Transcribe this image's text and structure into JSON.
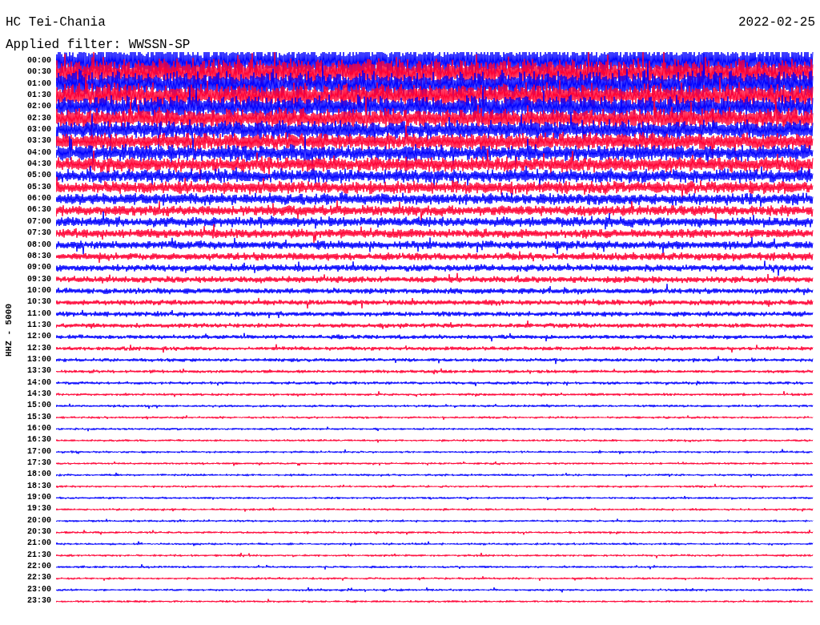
{
  "header": {
    "station": "HC Tei-Chania",
    "date": "2022-02-25",
    "filter": "Applied filter: WWSSN-SP"
  },
  "axis_label": "HHZ - 5000",
  "rows": [
    {
      "time": "00:00",
      "color": "#0000ff"
    },
    {
      "time": "00:30",
      "color": "#ff0033"
    },
    {
      "time": "01:00",
      "color": "#0000ff"
    },
    {
      "time": "01:30",
      "color": "#ff0033"
    },
    {
      "time": "02:00",
      "color": "#0000ff"
    },
    {
      "time": "02:30",
      "color": "#ff0033"
    },
    {
      "time": "03:00",
      "color": "#0000ff"
    },
    {
      "time": "03:30",
      "color": "#ff0033"
    },
    {
      "time": "04:00",
      "color": "#0000ff"
    },
    {
      "time": "04:30",
      "color": "#ff0033"
    },
    {
      "time": "05:00",
      "color": "#0000ff"
    },
    {
      "time": "05:30",
      "color": "#ff0033"
    },
    {
      "time": "06:00",
      "color": "#0000ff"
    },
    {
      "time": "06:30",
      "color": "#ff0033"
    },
    {
      "time": "07:00",
      "color": "#0000ff"
    },
    {
      "time": "07:30",
      "color": "#ff0033"
    },
    {
      "time": "08:00",
      "color": "#0000ff"
    },
    {
      "time": "08:30",
      "color": "#ff0033"
    },
    {
      "time": "09:00",
      "color": "#0000ff"
    },
    {
      "time": "09:30",
      "color": "#ff0033"
    },
    {
      "time": "10:00",
      "color": "#0000ff"
    },
    {
      "time": "10:30",
      "color": "#ff0033"
    },
    {
      "time": "11:00",
      "color": "#0000ff"
    },
    {
      "time": "11:30",
      "color": "#ff0033"
    },
    {
      "time": "12:00",
      "color": "#0000ff"
    },
    {
      "time": "12:30",
      "color": "#ff0033"
    },
    {
      "time": "13:00",
      "color": "#0000ff"
    },
    {
      "time": "13:30",
      "color": "#ff0033"
    },
    {
      "time": "14:00",
      "color": "#0000ff"
    },
    {
      "time": "14:30",
      "color": "#ff0033"
    },
    {
      "time": "15:00",
      "color": "#0000ff"
    },
    {
      "time": "15:30",
      "color": "#ff0033"
    },
    {
      "time": "16:00",
      "color": "#0000ff"
    },
    {
      "time": "16:30",
      "color": "#ff0033"
    },
    {
      "time": "17:00",
      "color": "#0000ff"
    },
    {
      "time": "17:30",
      "color": "#ff0033"
    },
    {
      "time": "18:00",
      "color": "#0000ff"
    },
    {
      "time": "18:30",
      "color": "#ff0033"
    },
    {
      "time": "19:00",
      "color": "#0000ff"
    },
    {
      "time": "19:30",
      "color": "#ff0033"
    },
    {
      "time": "20:00",
      "color": "#0000ff"
    },
    {
      "time": "20:30",
      "color": "#ff0033"
    },
    {
      "time": "21:00",
      "color": "#0000ff"
    },
    {
      "time": "21:30",
      "color": "#ff0033"
    },
    {
      "time": "22:00",
      "color": "#0000ff"
    },
    {
      "time": "22:30",
      "color": "#ff0033"
    },
    {
      "time": "23:00",
      "color": "#0000ff"
    },
    {
      "time": "23:30",
      "color": "#ff0033"
    }
  ]
}
